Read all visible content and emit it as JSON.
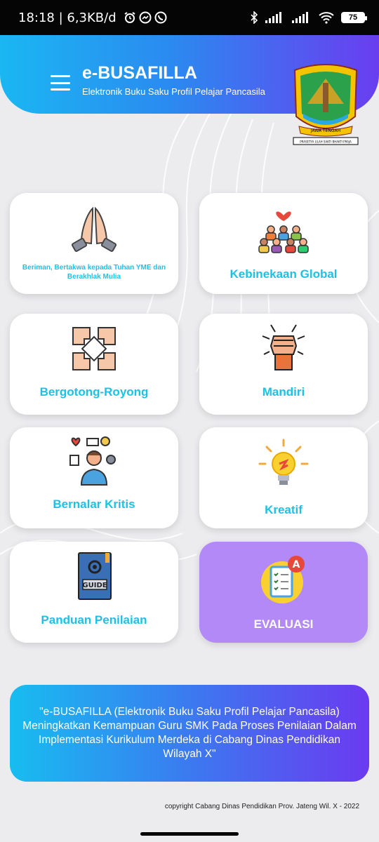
{
  "status_bar": {
    "time_speed": "18:18 | 6,3KB/d",
    "battery": "75",
    "icons": [
      "alarm-icon",
      "messenger-icon",
      "whatsapp-icon",
      "bluetooth-icon",
      "signal-icon",
      "signal-icon",
      "wifi-icon",
      "battery-icon"
    ]
  },
  "header": {
    "title": "e-BUSAFILLA",
    "subtitle": "Elektronik Buku Saku Profil Pelajar Pancasila",
    "logo_text": "JAWA TENGAH",
    "logo_motto": "PRASETYA ULAH SAKTI BHAKTI PRAJA",
    "colors": {
      "gradient_start": "#1ab7f2",
      "gradient_end": "#6a3df0"
    }
  },
  "cards": [
    {
      "label": "Beriman, Bertakwa kepada Tuhan YME dan Berakhlak Mulia",
      "icon": "praying-hands-icon"
    },
    {
      "label": "Kebinekaan Global",
      "icon": "diverse-people-icon"
    },
    {
      "label": "Bergotong-Royong",
      "icon": "joined-hands-icon"
    },
    {
      "label": "Mandiri",
      "icon": "raised-fist-icon"
    },
    {
      "label": "Bernalar Kritis",
      "icon": "critical-thinking-icon"
    },
    {
      "label": "Kreatif",
      "icon": "lightbulb-icon"
    },
    {
      "label": "Panduan Penilaian",
      "icon": "guide-book-icon"
    },
    {
      "label": "EVALUASI",
      "icon": "evaluation-icon"
    }
  ],
  "colors": {
    "card_label": "#1ec1e6",
    "evaluasi_card": "#b388f7"
  },
  "quote": "\"e-BUSAFILLA (Elektronik Buku Saku Profil Pelajar Pancasila) Meningkatkan Kemampuan Guru SMK Pada Proses Penilaian Dalam Implementasi Kurikulum Merdeka di Cabang Dinas Pendidikan Wilayah X\"",
  "copyright": "copyright Cabang Dinas Pendidikan Prov. Jateng Wil. X - 2022"
}
